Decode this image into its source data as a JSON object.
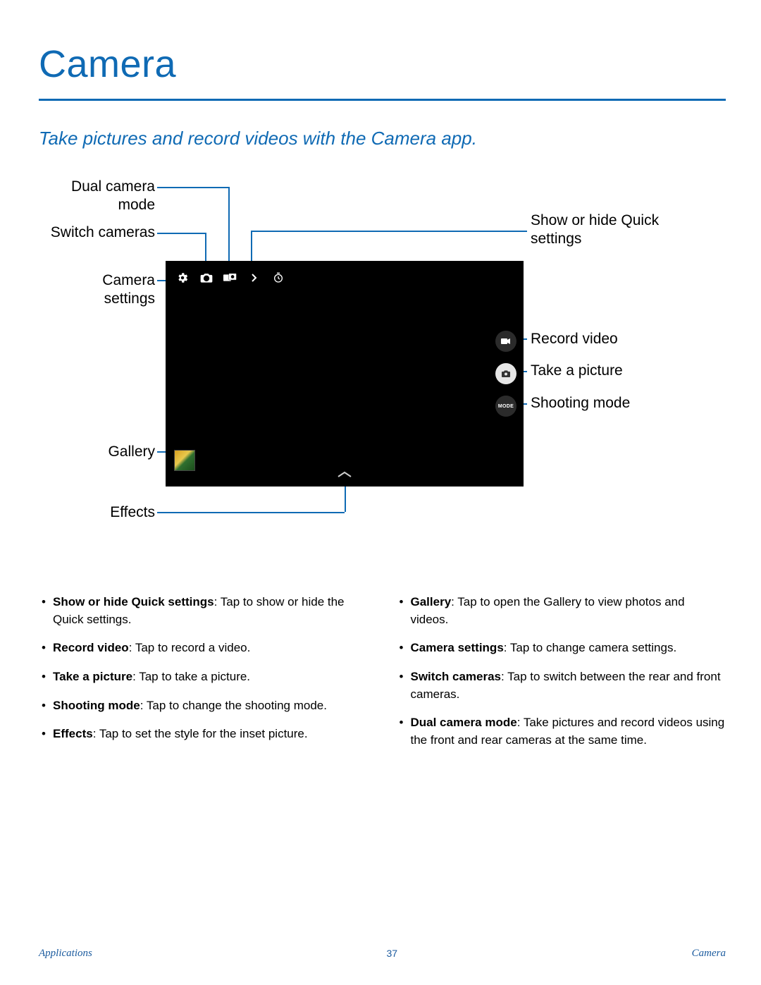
{
  "title": "Camera",
  "subtitle": "Take pictures and record videos with the Camera app.",
  "callouts": {
    "dual_camera": "Dual camera mode",
    "switch_cameras": "Switch cameras",
    "camera_settings": "Camera settings",
    "gallery": "Gallery",
    "effects": "Effects",
    "quick_settings": "Show or hide Quick settings",
    "record_video": "Record video",
    "take_picture": "Take a picture",
    "shooting_mode": "Shooting mode"
  },
  "viewport": {
    "mode_label": "MODE"
  },
  "bullets_left": [
    {
      "term": "Show or hide Quick settings",
      "desc": ": Tap to show or hide the Quick settings."
    },
    {
      "term": "Record video",
      "desc": ": Tap to record a video."
    },
    {
      "term": "Take a picture",
      "desc": ": Tap to take a picture."
    },
    {
      "term": "Shooting mode",
      "desc": ": Tap to change the shooting mode."
    },
    {
      "term": "Effects",
      "desc": ": Tap to set the style for the inset picture."
    }
  ],
  "bullets_right": [
    {
      "term": "Gallery",
      "desc": ": Tap to open the Gallery to view photos and videos."
    },
    {
      "term": "Camera settings",
      "desc": ": Tap to change camera settings."
    },
    {
      "term": "Switch cameras",
      "desc": ": Tap to switch between the rear and front cameras."
    },
    {
      "term": "Dual camera mode",
      "desc": ": Take pictures and record videos using the front and rear cameras at the same time."
    }
  ],
  "footer": {
    "left": "Applications",
    "center": "37",
    "right": "Camera"
  }
}
